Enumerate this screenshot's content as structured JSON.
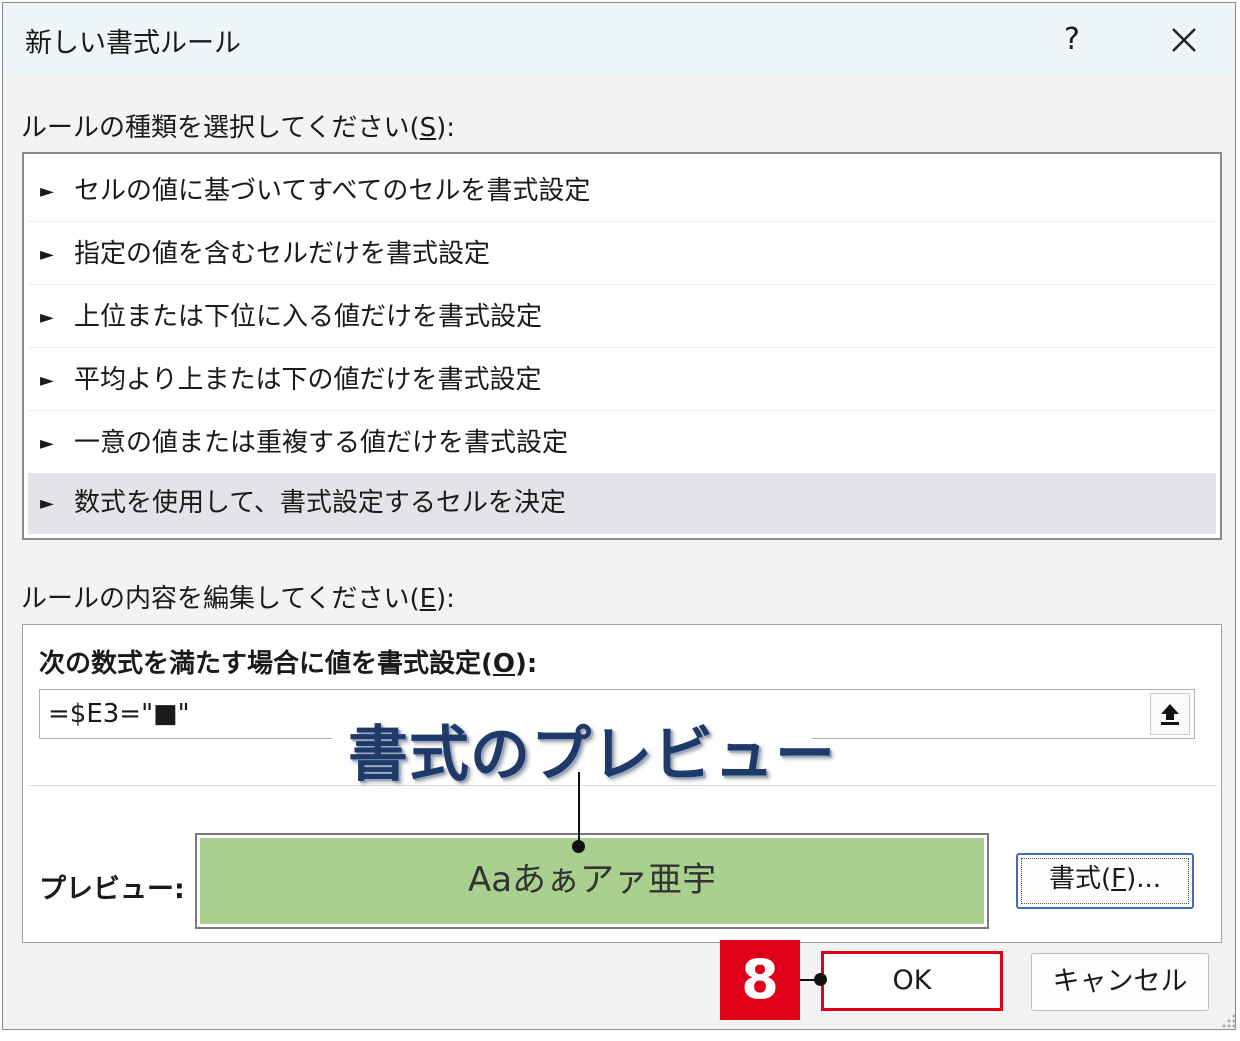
{
  "dialog": {
    "title": "新しい書式ルール",
    "help_label": "?"
  },
  "rule_type": {
    "label_prefix": "ルールの種類を選択してください(",
    "accesskey": "S",
    "label_suffix": "):",
    "items": [
      "セルの値に基づいてすべてのセルを書式設定",
      "指定の値を含むセルだけを書式設定",
      "上位または下位に入る値だけを書式設定",
      "平均より上または下の値だけを書式設定",
      "一意の値または重複する値だけを書式設定",
      "数式を使用して、書式設定するセルを決定"
    ],
    "selected_index": 5
  },
  "rule_edit": {
    "label_prefix": "ルールの内容を編集してください(",
    "accesskey": "E",
    "label_suffix": "):",
    "formula_label_prefix": "次の数式を満たす場合に値を書式設定(",
    "formula_accesskey": "O",
    "formula_label_suffix": "):",
    "formula_value": "=$E3=\"■\"",
    "collapse_icon": "collapse-arrow-icon",
    "preview_label": "プレビュー:",
    "preview_text": "Aaあぁアァ亜宇",
    "preview_fill": "#a9d08e",
    "format_button": {
      "prefix": "書式(",
      "accesskey": "F",
      "suffix": ")..."
    }
  },
  "buttons": {
    "ok": "OK",
    "cancel": "キャンセル"
  },
  "annotations": {
    "preview_callout": "書式のプレビュー",
    "step_number": "8",
    "highlight_color": "#e0001a"
  }
}
